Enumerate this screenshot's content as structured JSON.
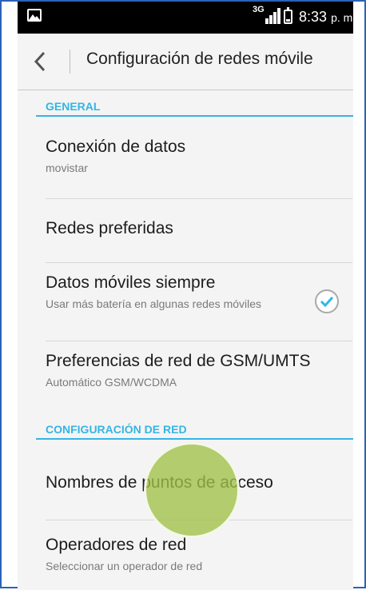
{
  "status_bar": {
    "network_type": "3G",
    "time": "8:33",
    "ampm": "p. m.",
    "icons": [
      "gallery-icon",
      "signal-icon",
      "battery-icon"
    ]
  },
  "action_bar": {
    "back_icon": "chevron-left-icon",
    "title": "Configuración de redes móvile"
  },
  "sections": [
    {
      "header": "GENERAL",
      "items": [
        {
          "title": "Conexión de datos",
          "subtitle": "movistar"
        },
        {
          "title": "Redes preferidas",
          "subtitle": ""
        },
        {
          "title": "Datos móviles siempre",
          "subtitle": "Usar más batería en algunas redes móviles",
          "checked": true
        },
        {
          "title": "Preferencias de red de GSM/UMTS",
          "subtitle": "Automático GSM/WCDMA"
        }
      ]
    },
    {
      "header": "CONFIGURACIÓN DE RED",
      "items": [
        {
          "title": "Nombres de puntos de acceso",
          "subtitle": ""
        },
        {
          "title": "Operadores de red",
          "subtitle": "Seleccionar un operador de red"
        }
      ]
    }
  ],
  "colors": {
    "accent": "#33b5e5",
    "status_bar": "#000000",
    "background": "#f4f4f4",
    "touch_indicator": "#a0c046",
    "frame_border": "#2c62b8"
  }
}
